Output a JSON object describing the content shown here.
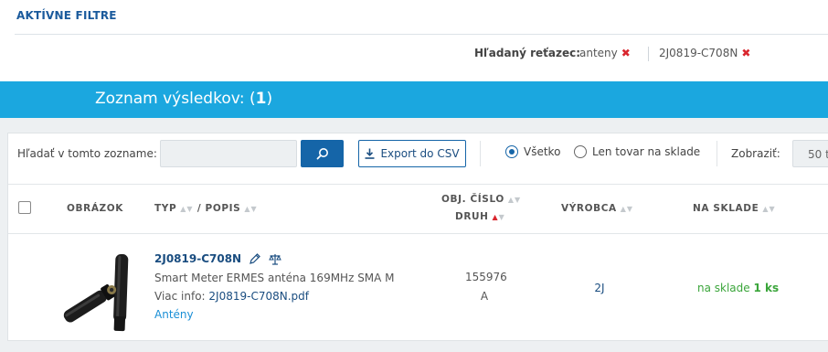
{
  "filters": {
    "title": "AKTÍVNE FILTRE",
    "label": "Hľadaný reťazec:",
    "chips": [
      {
        "text": "anteny",
        "remove": "✖"
      },
      {
        "text": "2J0819-C708N",
        "remove": "✖"
      }
    ]
  },
  "results": {
    "title_prefix": "Zoznam výsledkov: (",
    "count": "1",
    "title_suffix": ")"
  },
  "toolbar": {
    "search_label": "Hľadať v tomto zozname:",
    "search_value": "",
    "export_label": "Export do CSV",
    "radio_all": "Všetko",
    "radio_stock": "Len tovar na sklade",
    "selected_radio": "all",
    "show_label": "Zobraziť:",
    "show_value": "50 t"
  },
  "columns": {
    "image": "OBRÁZOK",
    "type": "TYP",
    "slash": " / ",
    "desc": "POPIS",
    "order_no": "OBJ. ČÍSLO",
    "kind": "DRUH",
    "manufacturer": "VÝROBCA",
    "stock": "NA SKLADE"
  },
  "rows": [
    {
      "type": "2J0819-C708N",
      "description": "Smart Meter ERMES anténa 169MHz SMA M",
      "more_label": "Viac info: ",
      "more_link": "2J0819-C708N.pdf",
      "category": "Antény",
      "order_no": "155976",
      "kind": "A",
      "manufacturer": "2J",
      "stock_prefix": "na sklade ",
      "stock_qty": "1 ks"
    }
  ],
  "colors": {
    "accent_blue": "#1ba7df",
    "dark_blue": "#1565a8",
    "link_blue": "#1a4d80",
    "remove_red": "#d9262e",
    "stock_green": "#3aa53a"
  }
}
